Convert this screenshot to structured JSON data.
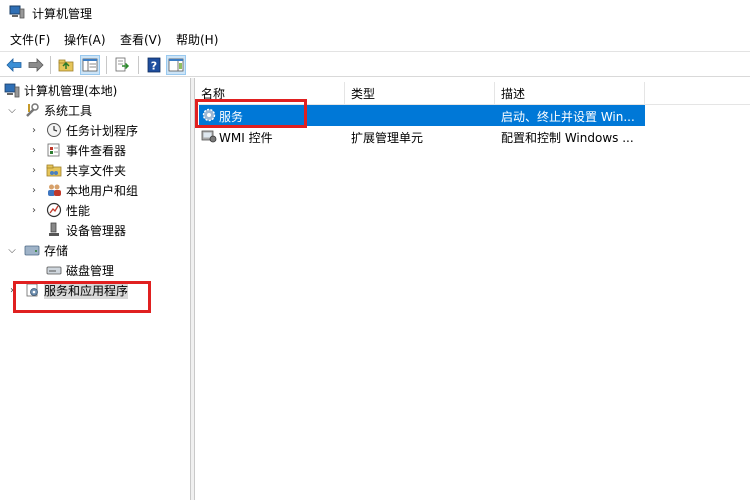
{
  "window": {
    "title": "计算机管理"
  },
  "menu": [
    "文件(F)",
    "操作(A)",
    "查看(V)",
    "帮助(H)"
  ],
  "toolbar": {
    "buttons": [
      "back-icon",
      "forward-icon",
      "up-folder-icon",
      "show-hide-tree-icon",
      "export-list-icon",
      "help-icon",
      "properties-pane-icon"
    ]
  },
  "tree": {
    "root": "计算机管理(本地)",
    "system_tools": "系统工具",
    "task_scheduler": "任务计划程序",
    "event_viewer": "事件查看器",
    "shared_folders": "共享文件夹",
    "local_users": "本地用户和组",
    "performance": "性能",
    "device_manager": "设备管理器",
    "storage": "存储",
    "disk_management": "磁盘管理",
    "services_apps": "服务和应用程序"
  },
  "list": {
    "columns": [
      "名称",
      "类型",
      "描述"
    ],
    "rows": [
      {
        "name": "服务",
        "type": "",
        "desc": "启动、终止并设置 Win..."
      },
      {
        "name": "WMI 控件",
        "type": "扩展管理单元",
        "desc": "配置和控制 Windows ..."
      }
    ]
  },
  "colors": {
    "selection": "#0078d7",
    "annotation": "#e02020"
  }
}
